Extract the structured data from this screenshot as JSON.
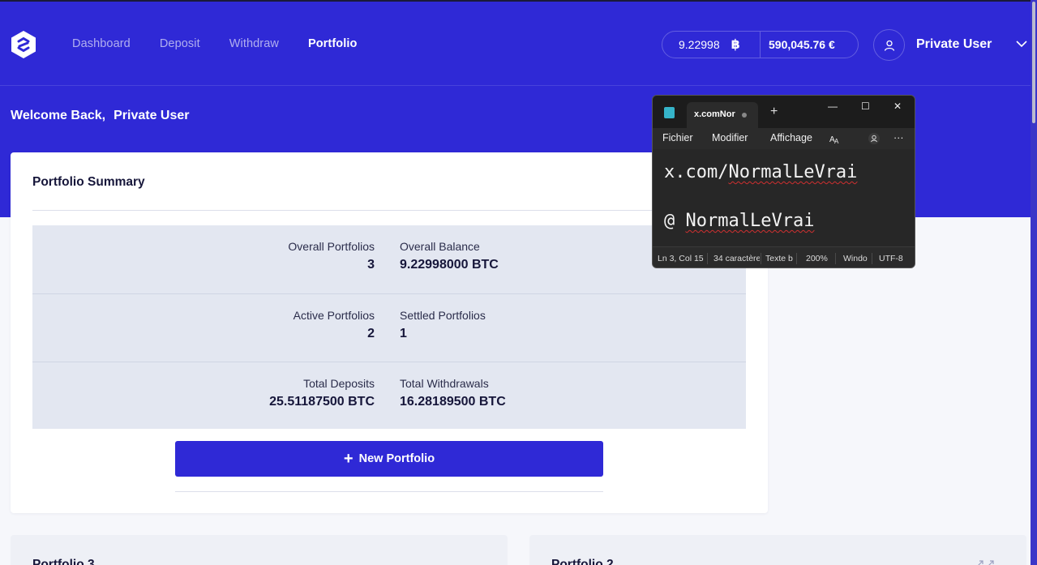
{
  "nav": {
    "links": [
      "Dashboard",
      "Deposit",
      "Withdraw",
      "Portfolio"
    ],
    "active": "Portfolio"
  },
  "balance": {
    "btc": "9.22998",
    "btc_symbol": "฿",
    "fiat": "590,045.76 €"
  },
  "user": {
    "name": "Private User"
  },
  "welcome": {
    "text": "Welcome Back,",
    "name": "Private User"
  },
  "summary": {
    "title": "Portfolio Summary",
    "rows": [
      {
        "left_label": "Overall Portfolios",
        "left_value": "3",
        "right_label": "Overall Balance",
        "right_value": "9.22998000 BTC"
      },
      {
        "left_label": "Active Portfolios",
        "left_value": "2",
        "right_label": "Settled Portfolios",
        "right_value": "1"
      },
      {
        "left_label": "Total Deposits",
        "left_value": "25.51187500 BTC",
        "right_label": "Total Withdrawals",
        "right_value": "16.28189500 BTC"
      }
    ],
    "new_button": "New Portfolio",
    "new_button_icon": "+"
  },
  "cards": [
    {
      "title": "Portfolio 3"
    },
    {
      "title": "Portfolio 2"
    }
  ],
  "notepad": {
    "tab_title": "x.comNor",
    "newtab": "+",
    "controls": {
      "minimize": "—",
      "maximize": "☐",
      "close": "✕"
    },
    "menu": [
      "Fichier",
      "Modifier",
      "Affichage"
    ],
    "more": "···",
    "lines": [
      {
        "plain": "x.com/",
        "underlined": "NormalLeVrai"
      },
      {
        "plain": "@ ",
        "underlined": "NormalLeVrai"
      }
    ],
    "status": {
      "position": "Ln 3, Col 15",
      "chars": "34 caractère",
      "type": "Texte b",
      "zoom": "200%",
      "eol": "Windo",
      "encoding": "UTF-8"
    }
  },
  "colors": {
    "brand": "#2f29d6",
    "stats_bg": "#e3e7f1",
    "notepad_bg": "#272727"
  }
}
